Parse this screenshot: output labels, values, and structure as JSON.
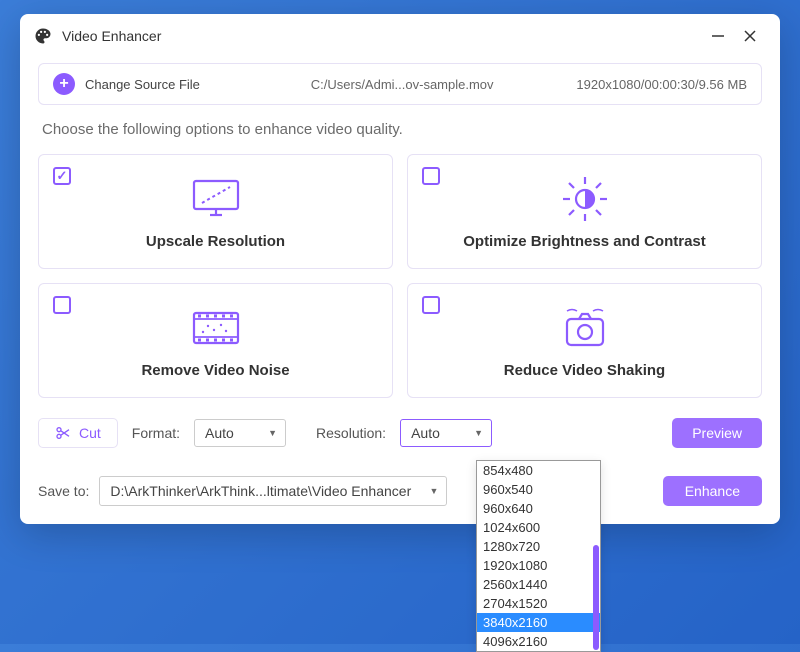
{
  "window": {
    "title": "Video Enhancer"
  },
  "source": {
    "change_label": "Change Source File",
    "path": "C:/Users/Admi...ov-sample.mov",
    "meta": "1920x1080/00:00:30/9.56 MB"
  },
  "instruction": "Choose the following options to enhance video quality.",
  "options": [
    {
      "label": "Upscale Resolution",
      "checked": true
    },
    {
      "label": "Optimize Brightness and Contrast",
      "checked": false
    },
    {
      "label": "Remove Video Noise",
      "checked": false
    },
    {
      "label": "Reduce Video Shaking",
      "checked": false
    }
  ],
  "toolbar": {
    "cut_label": "Cut",
    "format_label": "Format:",
    "format_value": "Auto",
    "resolution_label": "Resolution:",
    "resolution_value": "Auto",
    "preview_label": "Preview",
    "enhance_label": "Enhance"
  },
  "save": {
    "label": "Save to:",
    "path": "D:\\ArkThinker\\ArkThink...ltimate\\Video Enhancer"
  },
  "dropdown": {
    "items": [
      "854x480",
      "960x540",
      "960x640",
      "1024x600",
      "1280x720",
      "1920x1080",
      "2560x1440",
      "2704x1520",
      "3840x2160",
      "4096x2160"
    ],
    "selected_index": 8
  }
}
